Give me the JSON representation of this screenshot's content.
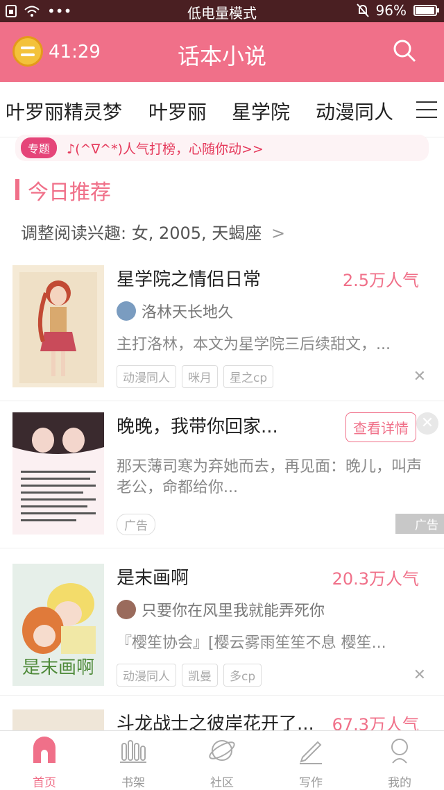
{
  "status_bar": {
    "mode": "低电量模式",
    "battery": "96%",
    "battery_level": 0.96
  },
  "header": {
    "timer": "41:29",
    "title": "话本小说"
  },
  "tabs": [
    "叶罗丽精灵梦",
    "叶罗丽",
    "星学院",
    "动漫同人"
  ],
  "banner": {
    "tag": "专题",
    "text": "♪(^∇^*)人气打榜，心随你动>>"
  },
  "section": {
    "title": "今日推荐",
    "interest": "调整阅读兴趣: 女, 2005, 天蝎座"
  },
  "items": [
    {
      "title": "星学院之情侣日常",
      "popularity": "2.5万人气",
      "author": "洛林天长地久",
      "desc": "主打洛林，本文为星学院三后续甜文，...",
      "tags": [
        "动漫同人",
        "咪月",
        "星之cp"
      ],
      "close": "✕"
    },
    {
      "title": "是末画啊",
      "popularity": "20.3万人气",
      "author": "只要你在风里我就能弄死你",
      "desc": "『樱笙协会』[樱云雾雨笙笙不息 樱笙...",
      "tags": [
        "动漫同人",
        "凯曼",
        "多cp"
      ],
      "close": "✕"
    },
    {
      "title": "斗龙战士之彼岸花开了...",
      "popularity": "67.3万人气"
    }
  ],
  "ad": {
    "title": "晚晚，我带你回家...",
    "button": "查看详情",
    "desc": "那天薄司寒为弃她而去，再见面：晚儿，叫声老公，命都给你...",
    "tag": "广告",
    "label": "广告",
    "close": "✕"
  },
  "cover2_text": "是末画啊",
  "bottom_nav": [
    "首页",
    "书架",
    "社区",
    "写作",
    "我的"
  ],
  "colors": {
    "accent": "#f07089",
    "status_bar": "#4a1f22"
  }
}
